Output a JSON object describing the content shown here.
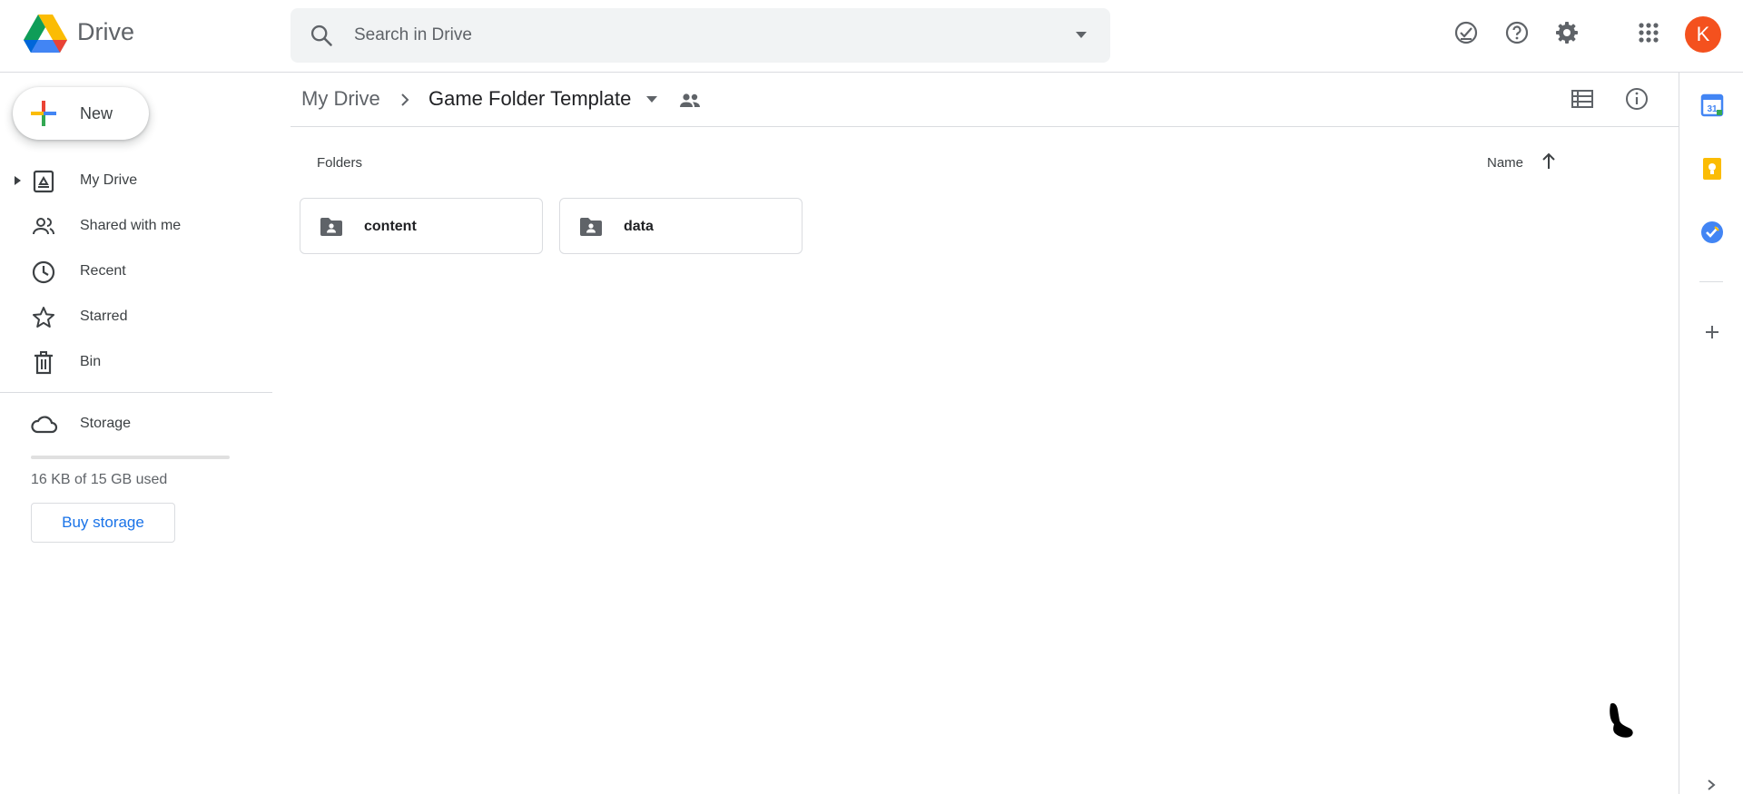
{
  "app": {
    "name": "Drive"
  },
  "search": {
    "placeholder": "Search in Drive"
  },
  "header_icons": [
    "ready-for-offline-icon",
    "help-icon",
    "settings-icon",
    "apps-grid-icon"
  ],
  "account": {
    "initial": "K",
    "color": "#f4511e"
  },
  "sidebar": {
    "new_label": "New",
    "items": [
      {
        "label": "My Drive",
        "icon": "my-drive-icon"
      },
      {
        "label": "Shared with me",
        "icon": "shared-with-me-icon"
      },
      {
        "label": "Recent",
        "icon": "clock-icon"
      },
      {
        "label": "Starred",
        "icon": "star-icon"
      },
      {
        "label": "Bin",
        "icon": "trash-icon"
      }
    ],
    "storage": {
      "label": "Storage",
      "used_text": "16 KB of 15 GB used",
      "used_fraction": 1e-06,
      "buy_label": "Buy storage"
    }
  },
  "breadcrumb": {
    "root": "My Drive",
    "current": "Game Folder Template"
  },
  "main": {
    "section_title": "Folders",
    "sort_label": "Name",
    "sort_direction": "ascending",
    "folders": [
      {
        "name": "content"
      },
      {
        "name": "data"
      }
    ]
  },
  "side_panel": {
    "apps": [
      "calendar-icon",
      "keep-icon",
      "tasks-icon",
      "add-icon"
    ]
  },
  "colors": {
    "accent": "#1a73e8",
    "keep": "#fbbc04",
    "tasks": "#4285f4"
  }
}
